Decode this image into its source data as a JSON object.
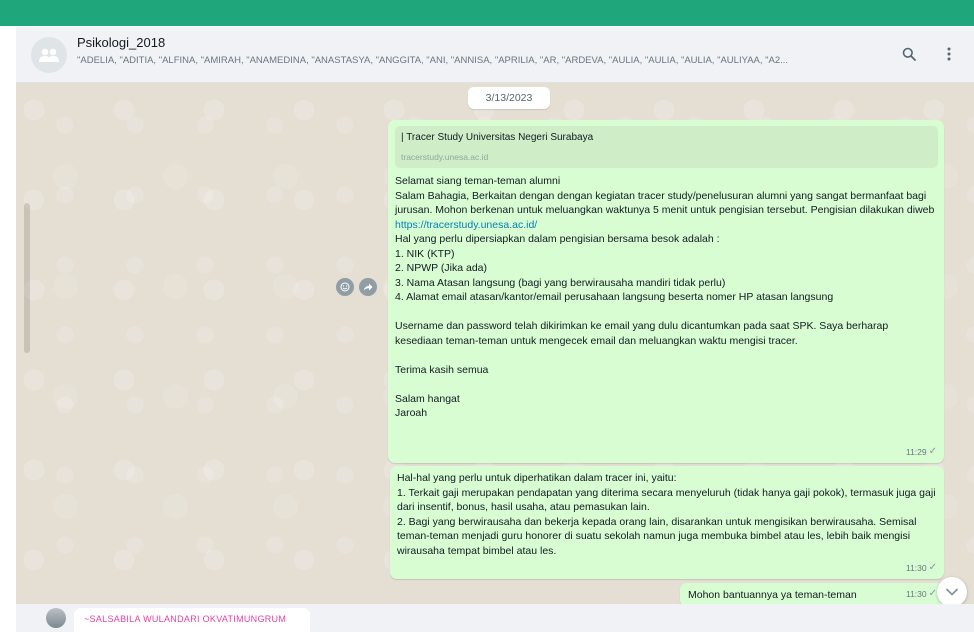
{
  "header": {
    "group_name": "Psikologi_2018",
    "members": "\"ADELIA, \"ADITIA, \"ALFINA, \"AMIRAH, \"ANAMEDINA, \"ANASTASYA, \"ANGGITA, \"ANI, \"ANNISA, \"APRILIA, \"AR, \"ARDEVA, \"AULIA, \"AULIA, \"AULIA, \"AULIYAA, \"A2...",
    "avatar_icon": "group-icon",
    "search_icon": "search-icon",
    "menu_icon": "menu-kebab-icon"
  },
  "chat": {
    "date": "3/13/2023",
    "messages": [
      {
        "link_preview": {
          "title": "| Tracer Study Universitas Negeri Surabaya",
          "url": "tracerstudy.unesa.ac.id"
        },
        "text_before_link": "Selamat siang teman-teman alumni\nSalam Bahagia, Berkaitan dengan dengan kegiatan tracer study/penelusuran alumni yang sangat bermanfaat bagi jurusan. Mohon berkenan untuk meluangkan waktunya 5 menit untuk pengisian tersebut. Pengisian dilakukan diweb ",
        "link": "https://tracerstudy.unesa.ac.id/",
        "text_after_link": "\nHal yang perlu dipersiapkan dalam pengisian bersama besok adalah :\n1. NIK (KTP)\n2. NPWP (Jika ada)\n3. Nama Atasan langsung (bagi yang berwirausaha mandiri tidak perlu)\n4. Alamat email atasan/kantor/email perusahaan langsung beserta nomer HP atasan langsung\n\nUsername dan password telah dikirimkan ke email yang dulu dicantumkan pada saat SPK. Saya berharap kesediaan teman-teman untuk mengecek email dan meluangkan waktu mengisi tracer.\n\nTerima kasih semua\n\nSalam hangat\nJaroah",
        "time": "11:29"
      },
      {
        "text": "Hal-hal yang perlu untuk diperhatikan dalam tracer ini, yaitu:\n1. Terkait gaji merupakan pendapatan yang diterima secara menyeluruh (tidak hanya gaji pokok), termasuk juga gaji dari insentif, bonus, hasil usaha, atau pemasukan lain.\n2. Bagi yang berwirausaha dan bekerja kepada orang lain, disarankan untuk mengisikan berwirausaha. Semisal teman-teman menjadi guru honorer di suatu sekolah namun juga membuka bimbel atau les, lebih baik mengisi wirausaha tempat bimbel atau les.",
        "time": "11:30"
      },
      {
        "text": "Mohon bantuannya ya teman-teman",
        "time": "11:30"
      }
    ],
    "next_sender": "~SALSABILA WULANDARI OKVATIMUNGRUM"
  },
  "colors": {
    "top_bar": "#1fa67a",
    "outgoing_bubble": "#d9fdd3",
    "chat_background": "#e4ded3",
    "link": "#027eb5",
    "sender_name": "#e542a3"
  }
}
